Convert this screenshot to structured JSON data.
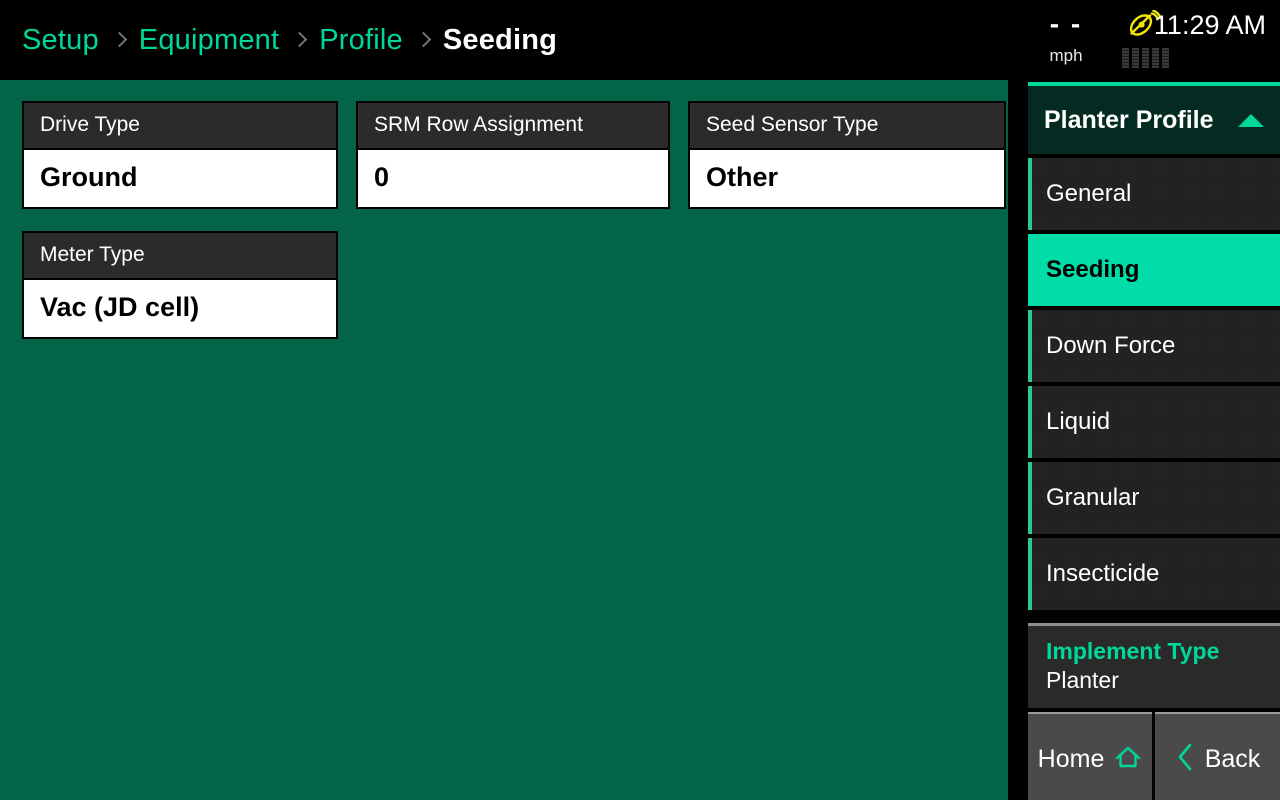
{
  "breadcrumb": {
    "items": [
      {
        "label": "Setup",
        "current": false
      },
      {
        "label": "Equipment",
        "current": false
      },
      {
        "label": "Profile",
        "current": false
      },
      {
        "label": "Seeding",
        "current": true
      }
    ],
    "separator_icon": "chevron-right-icon"
  },
  "status": {
    "speed_value": "- -",
    "speed_unit": "mph",
    "gps_icon": "satellite-dish-icon",
    "gps_icon_color": "#f2e600",
    "signal_bars": 5,
    "time": "11:29 AM"
  },
  "main": {
    "background_color": "#046448",
    "cards": [
      {
        "label": "Drive Type",
        "value": "Ground"
      },
      {
        "label": "SRM Row Assignment",
        "value": "0"
      },
      {
        "label": "Seed Sensor Type",
        "value": "Other"
      },
      {
        "label": "Meter Type",
        "value": "Vac (JD cell)"
      }
    ]
  },
  "sidebar": {
    "header": {
      "label": "Planter Profile",
      "caret_icon": "caret-up-icon"
    },
    "items": [
      {
        "label": "General",
        "selected": false
      },
      {
        "label": "Seeding",
        "selected": true
      },
      {
        "label": "Down Force",
        "selected": false
      },
      {
        "label": "Liquid",
        "selected": false
      },
      {
        "label": "Granular",
        "selected": false
      },
      {
        "label": "Insecticide",
        "selected": false
      }
    ],
    "implement": {
      "label": "Implement Type",
      "value": "Planter"
    },
    "buttons": [
      {
        "label": "Home",
        "icon": "home-icon"
      },
      {
        "label": "Back",
        "icon": "chevron-left-icon"
      }
    ],
    "accent_color": "#00dda9"
  }
}
